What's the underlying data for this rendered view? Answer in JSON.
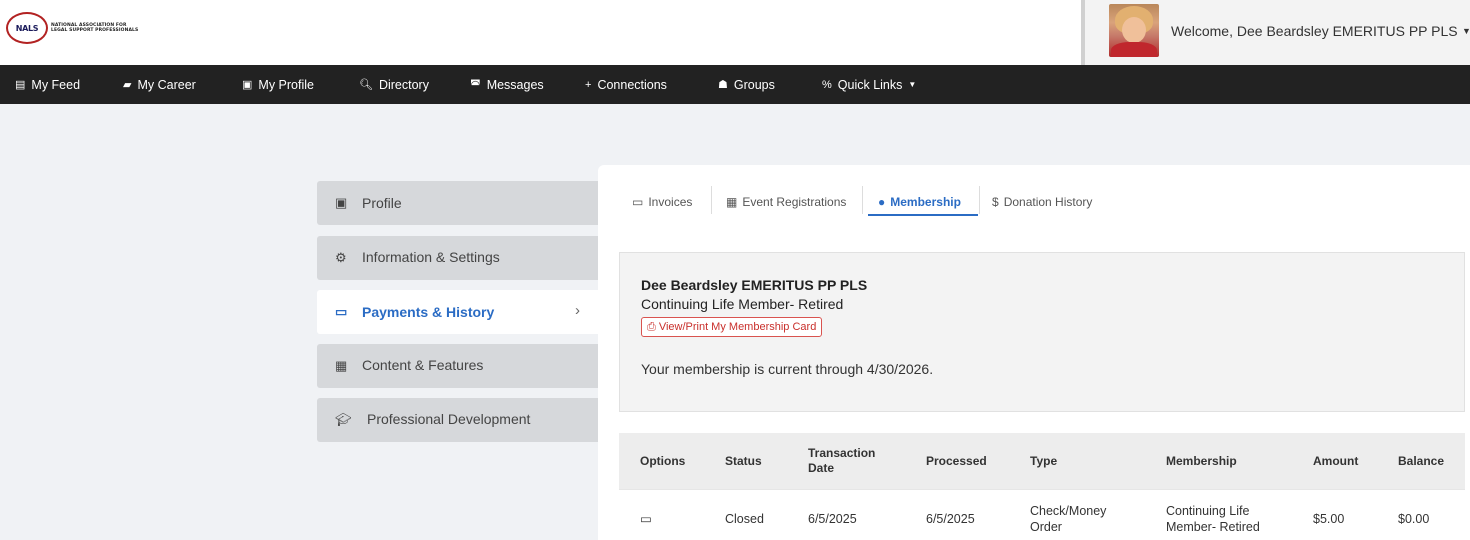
{
  "brand": {
    "seal_text": "NALS",
    "line1": "NATIONAL ASSOCIATION FOR",
    "line2": "LEGAL SUPPORT PROFESSIONALS"
  },
  "user": {
    "welcome": "Welcome, Dee Beardsley EMERITUS PP PLS"
  },
  "nav": {
    "items": [
      {
        "label": "My Feed",
        "icon": "feed-icon"
      },
      {
        "label": "My Career",
        "icon": "briefcase-icon"
      },
      {
        "label": "My Profile",
        "icon": "id-badge-icon"
      },
      {
        "label": "Directory",
        "icon": "search-icon"
      },
      {
        "label": "Messages",
        "icon": "inbox-icon"
      },
      {
        "label": "Connections",
        "icon": "user-plus-icon"
      },
      {
        "label": "Groups",
        "icon": "users-icon"
      },
      {
        "label": "Quick Links",
        "icon": "percent-icon"
      }
    ]
  },
  "sidebar": {
    "items": [
      {
        "label": "Profile",
        "icon": "id-badge-icon"
      },
      {
        "label": "Information & Settings",
        "icon": "cogs-icon"
      },
      {
        "label": "Payments & History",
        "icon": "money-bill-icon",
        "active": true
      },
      {
        "label": "Content & Features",
        "icon": "table-icon"
      },
      {
        "label": "Professional Development",
        "icon": "graduation-cap-icon"
      }
    ]
  },
  "tabs": [
    {
      "label": "Invoices",
      "icon": "money-bill-icon"
    },
    {
      "label": "Event Registrations",
      "icon": "calendar-icon"
    },
    {
      "label": "Membership",
      "icon": "user-icon",
      "active": true
    },
    {
      "label": "Donation History",
      "icon": "dollar-icon"
    }
  ],
  "membership": {
    "name": "Dee Beardsley EMERITUS PP PLS",
    "type": "Continuing Life Member- Retired",
    "card_button": "View/Print My Membership Card",
    "current_text": "Your membership is current through 4/30/2026."
  },
  "table": {
    "headers": [
      "Options",
      "Status",
      "Transaction Date",
      "Processed",
      "Type",
      "Membership",
      "Amount",
      "Balance"
    ],
    "rows": [
      {
        "status": "Closed",
        "transaction_date": "6/5/2025",
        "processed": "6/5/2025",
        "type": "Check/Money Order",
        "membership": "Continuing Life Member- Retired",
        "amount": "$5.00",
        "balance": "$0.00"
      }
    ]
  },
  "colors": {
    "nav_bg": "#222222",
    "accent": "#2b6cc4",
    "danger": "#c9302c",
    "page_bg": "#f0f2f5"
  }
}
